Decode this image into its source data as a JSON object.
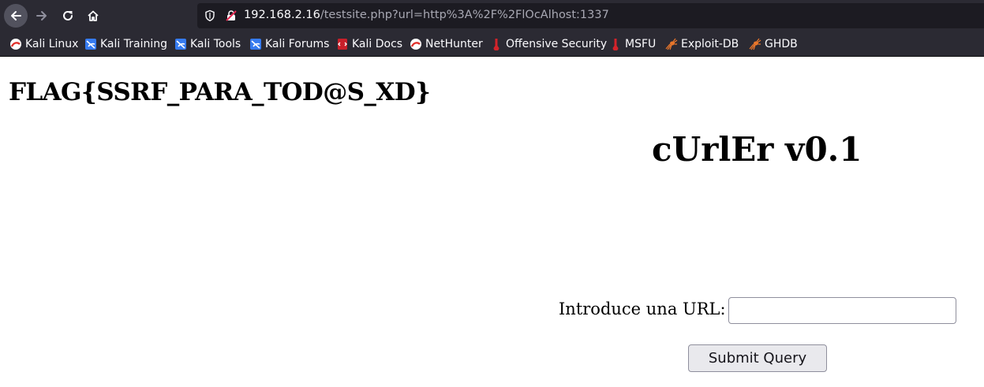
{
  "browser": {
    "url_host": "192.168.2.16",
    "url_path": "/testsite.php?url=http%3A%2F%2FlOcAlhost:1337",
    "bookmarks": [
      {
        "label": "Kali Linux",
        "icon": "kali-dragon-icon"
      },
      {
        "label": "Kali Training",
        "icon": "kali-training-icon"
      },
      {
        "label": "Kali Tools",
        "icon": "kali-tools-icon"
      },
      {
        "label": "Kali Forums",
        "icon": "kali-forums-icon"
      },
      {
        "label": "Kali Docs",
        "icon": "kali-docs-icon"
      },
      {
        "label": "NetHunter",
        "icon": "nethunter-icon"
      },
      {
        "label": "Offensive Security",
        "icon": "offsec-icon"
      },
      {
        "label": "MSFU",
        "icon": "msfu-icon"
      },
      {
        "label": "Exploit-DB",
        "icon": "exploit-db-spider-icon"
      },
      {
        "label": "GHDB",
        "icon": "ghdb-spider-icon"
      }
    ]
  },
  "page": {
    "flag": "FLAG{SSRF_PARA_TOD@S_XD}",
    "title": "cUrlEr v0.1",
    "url_label": "Introduce una URL:",
    "url_input_value": "",
    "submit_label": "Submit Query"
  },
  "colors": {
    "chrome_bg": "#2b2a33",
    "urlbar_bg": "#1c1b22",
    "kali_red": "#e0312b",
    "kali_blue": "#367bf0",
    "exploit_orange": "#e8762b"
  }
}
